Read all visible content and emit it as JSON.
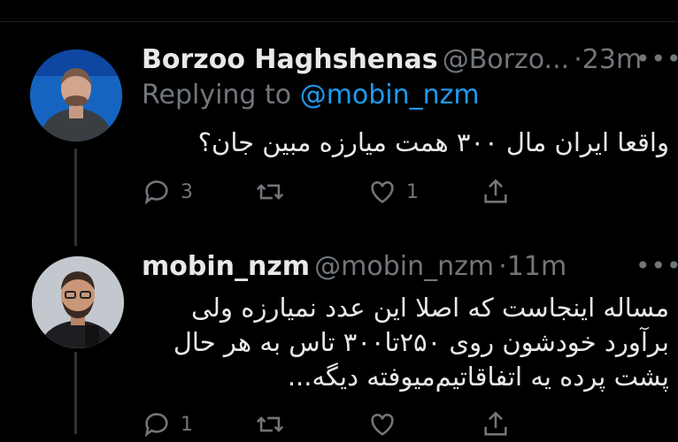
{
  "tweets": [
    {
      "author_name": "Borzoo Haghshenas",
      "handle": "@Borzo...",
      "time": "23m",
      "replying_prefix": "Replying to",
      "replying_mention": "@mobin_nzm",
      "text": "واقعا ایران مال ۳۰۰ همت میارزه مبین جان؟",
      "replies": "3",
      "retweets": "",
      "likes": "1"
    },
    {
      "author_name": "mobin_nzm",
      "handle": "@mobin_nzm",
      "time": "11m",
      "text_lines": [
        "مساله اینجاست که اصلا این عدد نمیارزه ولی",
        "برآورد خودشون روی ۲۵۰تا۳۰۰ تاس  به هر حال",
        "پشت پرده یه اتفاقاتیم‌میوفته دیگه..."
      ],
      "replies": "1"
    }
  ],
  "icons": {
    "reply": "reply-icon",
    "retweet": "retweet-icon",
    "like": "heart-icon",
    "share": "share-icon",
    "more": "more-icon"
  }
}
